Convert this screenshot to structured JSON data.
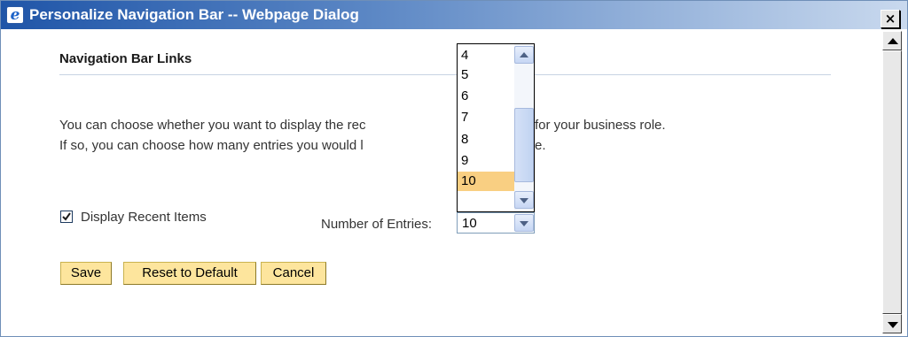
{
  "window": {
    "title": "Personalize Navigation Bar -- Webpage Dialog",
    "close_glyph": "×",
    "icon": "ie-icon"
  },
  "section": {
    "title": "Navigation Bar Links",
    "desc_line1": "You can choose whether you want to display the rec",
    "desc_line1_end": "for your business role.",
    "desc_line2": "If so, you can choose how many entries you would l",
    "desc_line2_end": "e."
  },
  "recent_items": {
    "checkbox_label": "Display Recent Items",
    "checked": true
  },
  "entries": {
    "label": "Number of Entries:",
    "value": "10",
    "options": [
      "4",
      "5",
      "6",
      "7",
      "8",
      "9",
      "10"
    ],
    "selected": "10"
  },
  "buttons": {
    "save": "Save",
    "reset": "Reset to Default",
    "cancel": "Cancel"
  },
  "colors": {
    "button_bg": "#fde59d",
    "selected_option": "#f9cf82",
    "titlebar": "#1f55a8"
  }
}
